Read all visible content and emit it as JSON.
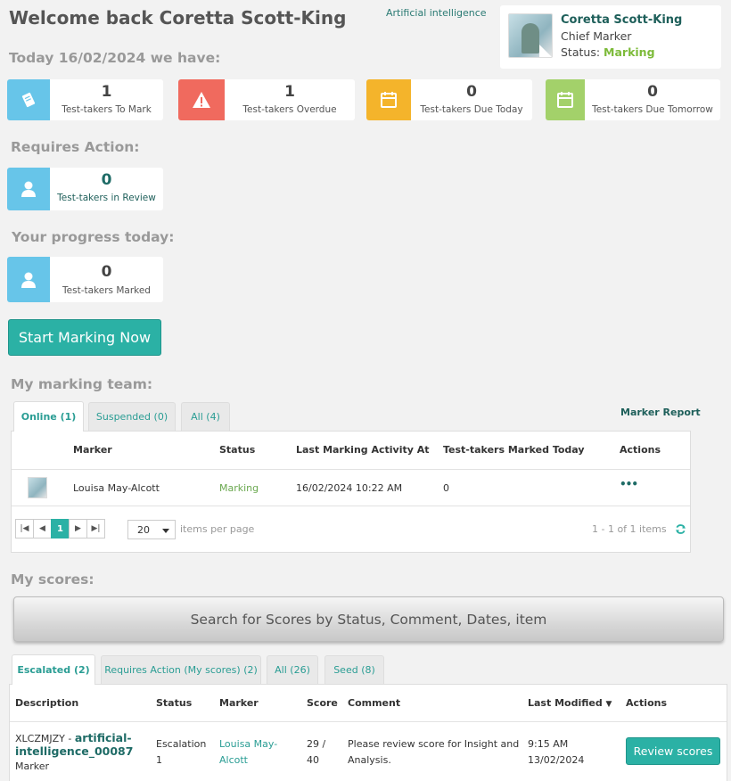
{
  "header": {
    "welcome": "Welcome back Coretta Scott-King",
    "subject_link": "Artificial intelligence",
    "today": "Today 16/02/2024 we have:"
  },
  "profile": {
    "name": "Coretta Scott-King",
    "role": "Chief Marker",
    "status_label": "Status:",
    "status_value": "Marking"
  },
  "summary_cards": [
    {
      "value": "1",
      "label": "Test-takers To Mark",
      "color": "#67c5e9",
      "icon": "book-icon"
    },
    {
      "value": "1",
      "label": "Test-takers Overdue",
      "color": "#f06a5e",
      "icon": "warning-icon"
    },
    {
      "value": "0",
      "label": "Test-takers Due Today",
      "color": "#f4b42b",
      "icon": "calendar-icon"
    },
    {
      "value": "0",
      "label": "Test-takers Due Tomorrow",
      "color": "#a3d16a",
      "icon": "calendar-icon"
    }
  ],
  "requires_action": {
    "heading": "Requires Action:",
    "value": "0",
    "label": "Test-takers in Review"
  },
  "progress": {
    "heading": "Your progress today:",
    "value": "0",
    "label": "Test-takers Marked"
  },
  "start_button": "Start Marking Now",
  "team": {
    "heading": "My marking team:",
    "tabs": [
      "Online (1)",
      "Suspended (0)",
      "All (4)"
    ],
    "report_link": "Marker Report",
    "columns": [
      "Marker",
      "Status",
      "Last Marking Activity At",
      "Test-takers Marked Today",
      "Actions"
    ],
    "rows": [
      {
        "marker": "Louisa May-Alcott",
        "status": "Marking",
        "last_activity": "16/02/2024 10:22 AM",
        "marked_today": "0",
        "actions": "•••"
      }
    ],
    "pager": {
      "first": "|◀",
      "prev": "◀",
      "current": "1",
      "next": "▶",
      "last": "▶|"
    },
    "page_size": "20",
    "items_per_page": "items per page",
    "range": "1 - 1 of 1 items"
  },
  "scores": {
    "heading": "My scores:",
    "search_label": "Search for Scores by Status, Comment, Dates, item",
    "tabs": [
      "Escalated (2)",
      "Requires Action (My scores) (2)",
      "All (26)",
      "Seed (8)"
    ],
    "columns": [
      "Description",
      "Status",
      "Marker",
      "Score",
      "Comment",
      "Last Modified",
      "Actions"
    ],
    "sort_indicator": "▼",
    "rows": [
      {
        "code": "XLCZMJZY -",
        "item_line1": "artificial-",
        "item_line2": "intelligence_00087",
        "role": "Marker",
        "status_line1": "Escalation",
        "status_line2": "1",
        "marker_line1": "Louisa May-",
        "marker_line2": "Alcott",
        "score_line1": "29 /",
        "score_line2": "40",
        "comment_line1": "Please review score for Insight and",
        "comment_line2": "Analysis.",
        "modified_line1": "9:15 AM",
        "modified_line2": "13/02/2024",
        "action": "Review scores"
      }
    ]
  }
}
